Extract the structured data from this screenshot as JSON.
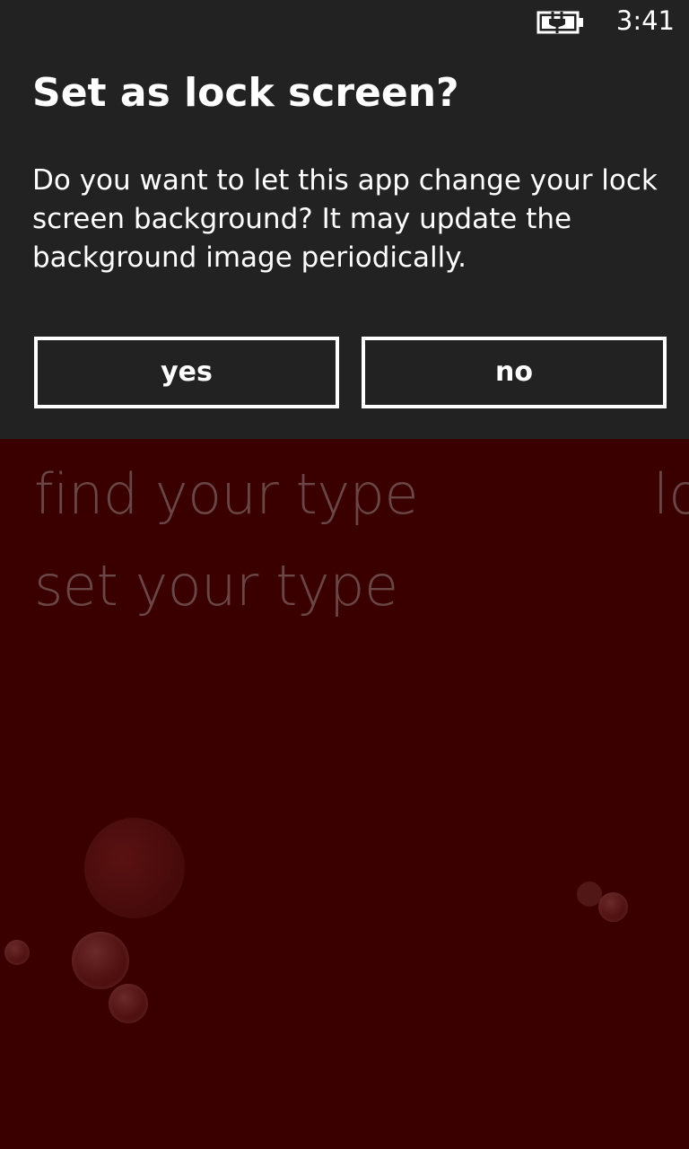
{
  "status_bar": {
    "time": "3:41",
    "battery_icon": "battery-charging-icon"
  },
  "dialog": {
    "title": "Set as lock screen?",
    "message": "Do you want to let this app change your lock screen background? It may update the background image periodically.",
    "yes_label": "yes",
    "no_label": "no"
  },
  "app": {
    "menu_items": [
      "find your type",
      "set your type"
    ],
    "next_pivot_peek": "lo"
  },
  "colors": {
    "background": "#3a0000",
    "dialog_background": "#222222",
    "text": "#ffffff",
    "muted_text": "#6a4646"
  }
}
